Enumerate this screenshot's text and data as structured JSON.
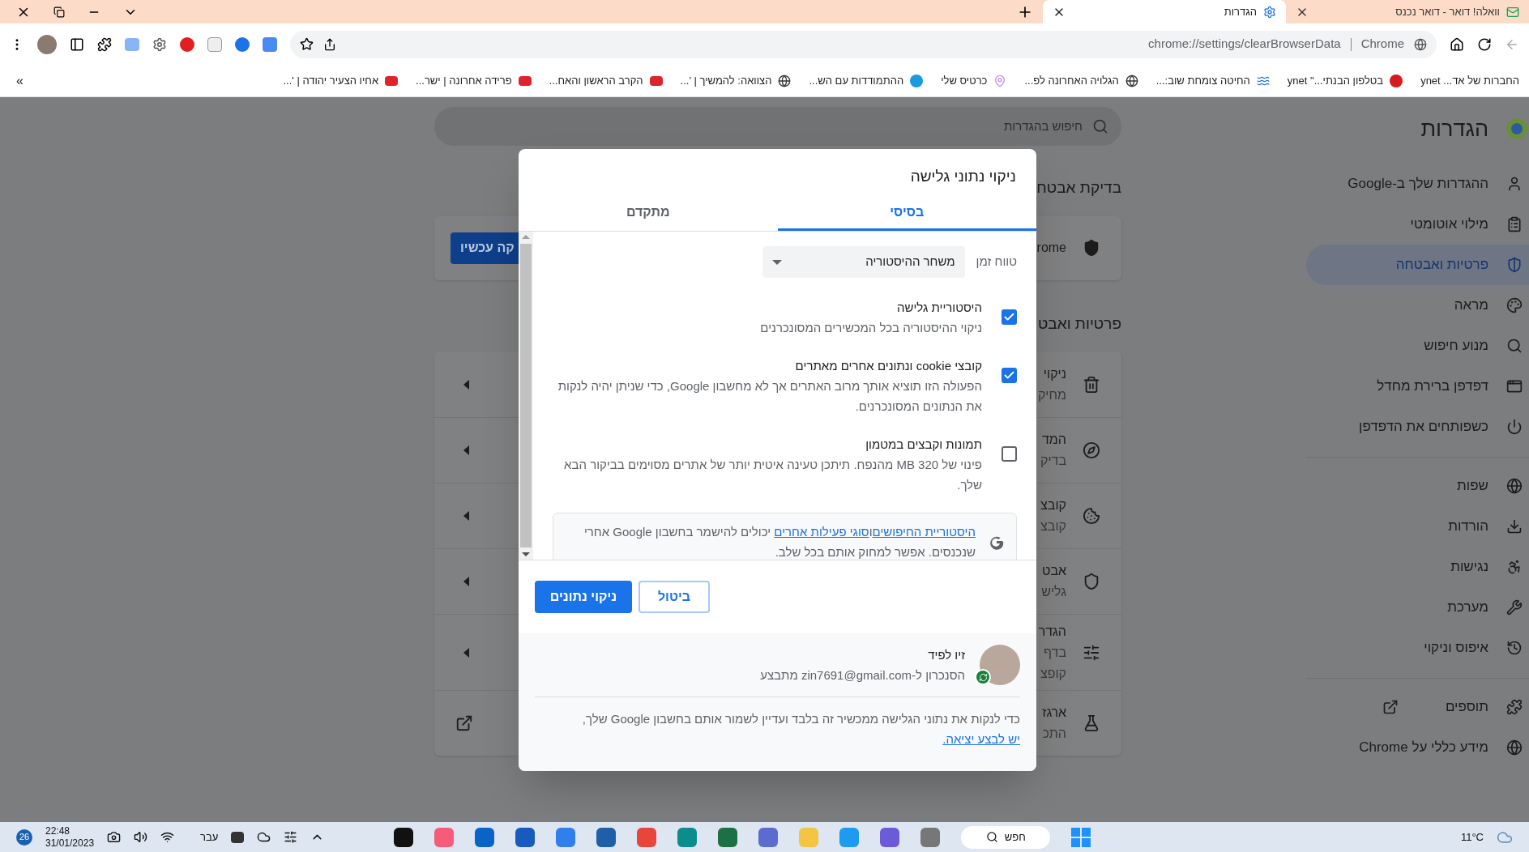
{
  "tabs": [
    {
      "title": "וואלה! דואר - דואר נכנס",
      "kind": "mail",
      "selected": false
    },
    {
      "title": "הגדרות",
      "kind": "settings",
      "selected": true
    }
  ],
  "address_bar": {
    "chip": "Chrome",
    "url": "chrome://settings/clearBrowserData"
  },
  "bookmarks": [
    {
      "title": "החברות של אד... ynet",
      "kind": "plain"
    },
    {
      "title": "בטלפון הבנתי...\" ynet",
      "kind": "red"
    },
    {
      "title": "החיטה צומחת שוב:...",
      "kind": "wave"
    },
    {
      "title": "הגלויה האחרונה לפ...",
      "kind": "globe"
    },
    {
      "title": "כרטיס שלי",
      "kind": "pin"
    },
    {
      "title": "ההתמודדות עם הש...",
      "kind": "blue"
    },
    {
      "title": "הצוואה: להמשיך | '...",
      "kind": "globe"
    },
    {
      "title": "הקרב הראשון והאח...",
      "kind": "news"
    },
    {
      "title": "פרידה אחרונה | ישר...",
      "kind": "news"
    },
    {
      "title": "אחיו הצעיר יהודה | '...",
      "kind": "news"
    }
  ],
  "bookmarks_overflow": "»",
  "sidebar": {
    "title": "הגדרות",
    "sections": [
      [
        {
          "label": "ההגדרות שלך ב-Google",
          "selected": false
        },
        {
          "label": "מילוי אוטומטי",
          "selected": false
        },
        {
          "label": "פרטיות ואבטחה",
          "selected": true
        },
        {
          "label": "מראה",
          "selected": false
        },
        {
          "label": "מנוע חיפוש",
          "selected": false
        },
        {
          "label": "דפדפן ברירת מחדל",
          "selected": false
        },
        {
          "label": "כשפותחים את הדפדפן",
          "selected": false
        }
      ],
      [
        {
          "label": "שפות",
          "selected": false
        },
        {
          "label": "הורדות",
          "selected": false
        },
        {
          "label": "נגישות",
          "selected": false
        },
        {
          "label": "מערכת",
          "selected": false
        },
        {
          "label": "איפוס וניקוי",
          "selected": false
        }
      ],
      [
        {
          "label": "תוספים",
          "selected": false
        },
        {
          "label": "מידע כללי על Chrome",
          "selected": false
        }
      ]
    ]
  },
  "search": {
    "placeholder": "חיפוש בהגדרות"
  },
  "safety_check": {
    "heading": "בדיקת אבטח",
    "text": "rome",
    "button": "קה עכשיו"
  },
  "privacy": {
    "heading": "פרטיות ואבט",
    "rows": [
      {
        "lines": [
          "ניקוי",
          "מחיק"
        ],
        "kind": "arrow"
      },
      {
        "lines": [
          "המד",
          "בדיק"
        ],
        "kind": "arrow"
      },
      {
        "lines": [
          "קובצ",
          "קובצ"
        ],
        "kind": "arrow"
      },
      {
        "lines": [
          "אבט",
          "גליש"
        ],
        "kind": "arrow"
      },
      {
        "lines": [
          "הגדר",
          "בדף",
          "קופצ"
        ],
        "kind": "arrow"
      },
      {
        "lines": [
          "ארגז",
          "התכ"
        ],
        "kind": "external"
      }
    ]
  },
  "dialog": {
    "title": "ניקוי נתוני גלישה",
    "tabs": [
      {
        "label": "בסיסי",
        "selected": true
      },
      {
        "label": "מתקדם",
        "selected": false
      }
    ],
    "time_range": {
      "label": "טווח זמן",
      "value": "משחר ההיסטוריה"
    },
    "options": [
      {
        "title": "היסטוריית גלישה",
        "description": "ניקוי ההיסטוריה בכל המכשירים המסונכרנים",
        "checked": true
      },
      {
        "title": "קובצי cookie ונתונים אחרים מאתרים",
        "description": "הפעולה הזו תוציא אותך מרוב האתרים אך לא מחשבון Google, כדי שניתן יהיה לנקות את הנתונים המסונכרנים.",
        "checked": true
      },
      {
        "title": "תמונות וקבצים במטמון",
        "description": "פינוי של MB 320 מהנפח. תיתכן טעינה איטית יותר של אתרים מסוימים בביקור הבא שלך.",
        "checked": false
      }
    ],
    "info": [
      {
        "kind": "link",
        "text": "היסטוריית החיפושים"
      },
      {
        "kind": "text",
        "text": "ו"
      },
      {
        "kind": "link",
        "text": "סוגי פעילות אחרים"
      },
      {
        "kind": "text",
        "text": " יכולים להישמר בחשבון Google אחרי שנכנסים. אפשר למחוק אותם בכל שלב."
      }
    ],
    "buttons": [
      {
        "label": "ביטול",
        "kind": "secondary"
      },
      {
        "label": "ניקוי נתונים",
        "kind": "primary"
      }
    ],
    "account": {
      "name": "זיו לפיד",
      "sync_status": "הסנכרון ל-zin7691@gmail.com מתבצע"
    },
    "note": [
      {
        "kind": "text",
        "text": "כדי לנקות את נתוני הגלישה ממכשיר זה בלבד ועדיין לשמור אותם בחשבון Google שלך, "
      },
      {
        "kind": "link",
        "text": "יש לבצע יציאה."
      }
    ]
  },
  "taskbar": {
    "badge": "26",
    "time": "22:48",
    "date": "31/01/2023",
    "language": "עבר",
    "search": "חפש",
    "weather": "11°C"
  }
}
